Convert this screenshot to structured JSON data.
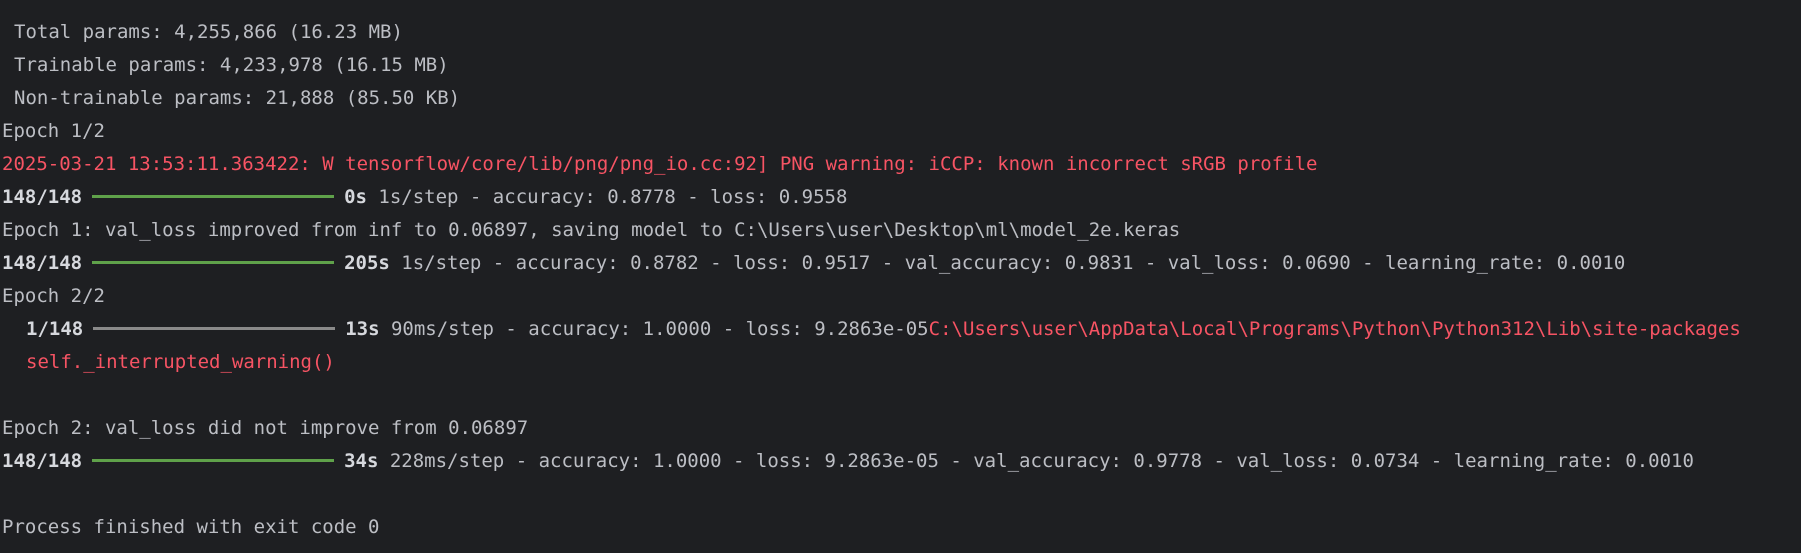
{
  "summary": {
    "total": "Total params: 4,255,866 (16.23 MB)",
    "trainable": "Trainable params: 4,233,978 (16.15 MB)",
    "non_trainable": "Non-trainable params: 21,888 (85.50 KB)"
  },
  "epoch1": {
    "header": "Epoch 1/2",
    "warning": "2025-03-21 13:53:11.363422: W tensorflow/core/lib/png/png_io.cc:92] PNG warning: iCCP: known incorrect sRGB profile",
    "progress_a": {
      "counter": "148/148",
      "fraction": 1.0,
      "time": "0s",
      "rest": "1s/step - accuracy: 0.8778 - loss: 0.9558"
    },
    "checkpoint": "Epoch 1: val_loss improved from inf to 0.06897, saving model to C:\\Users\\user\\Desktop\\ml\\model_2e.keras",
    "progress_b": {
      "counter": "148/148",
      "fraction": 1.0,
      "time": "205s",
      "rest": "1s/step - accuracy: 0.8782 - loss: 0.9517 - val_accuracy: 0.9831 - val_loss: 0.0690 - learning_rate: 0.0010"
    }
  },
  "epoch2": {
    "header": "Epoch 2/2",
    "progress_a": {
      "counter": "1/148",
      "fraction": 0.0,
      "time": "13s",
      "rest": "90ms/step - accuracy: 1.0000 - loss: 9.2863e-05",
      "error_path": "C:\\Users\\user\\AppData\\Local\\Programs\\Python\\Python312\\Lib\\site-packages"
    },
    "error_call": "self._interrupted_warning()",
    "checkpoint": "Epoch 2: val_loss did not improve from 0.06897",
    "progress_b": {
      "counter": "148/148",
      "fraction": 1.0,
      "time": "34s",
      "rest": "228ms/step - accuracy: 1.0000 - loss: 9.2863e-05 - val_accuracy: 0.9778 - val_loss: 0.0734 - learning_rate: 0.0010"
    }
  },
  "exit_message": "Process finished with exit code 0",
  "colors": {
    "background": "#1e1f22",
    "text": "#bcbec4",
    "error": "#f75464",
    "bar_done": "#5fa14a",
    "bar_pending": "#8a8a8a"
  }
}
